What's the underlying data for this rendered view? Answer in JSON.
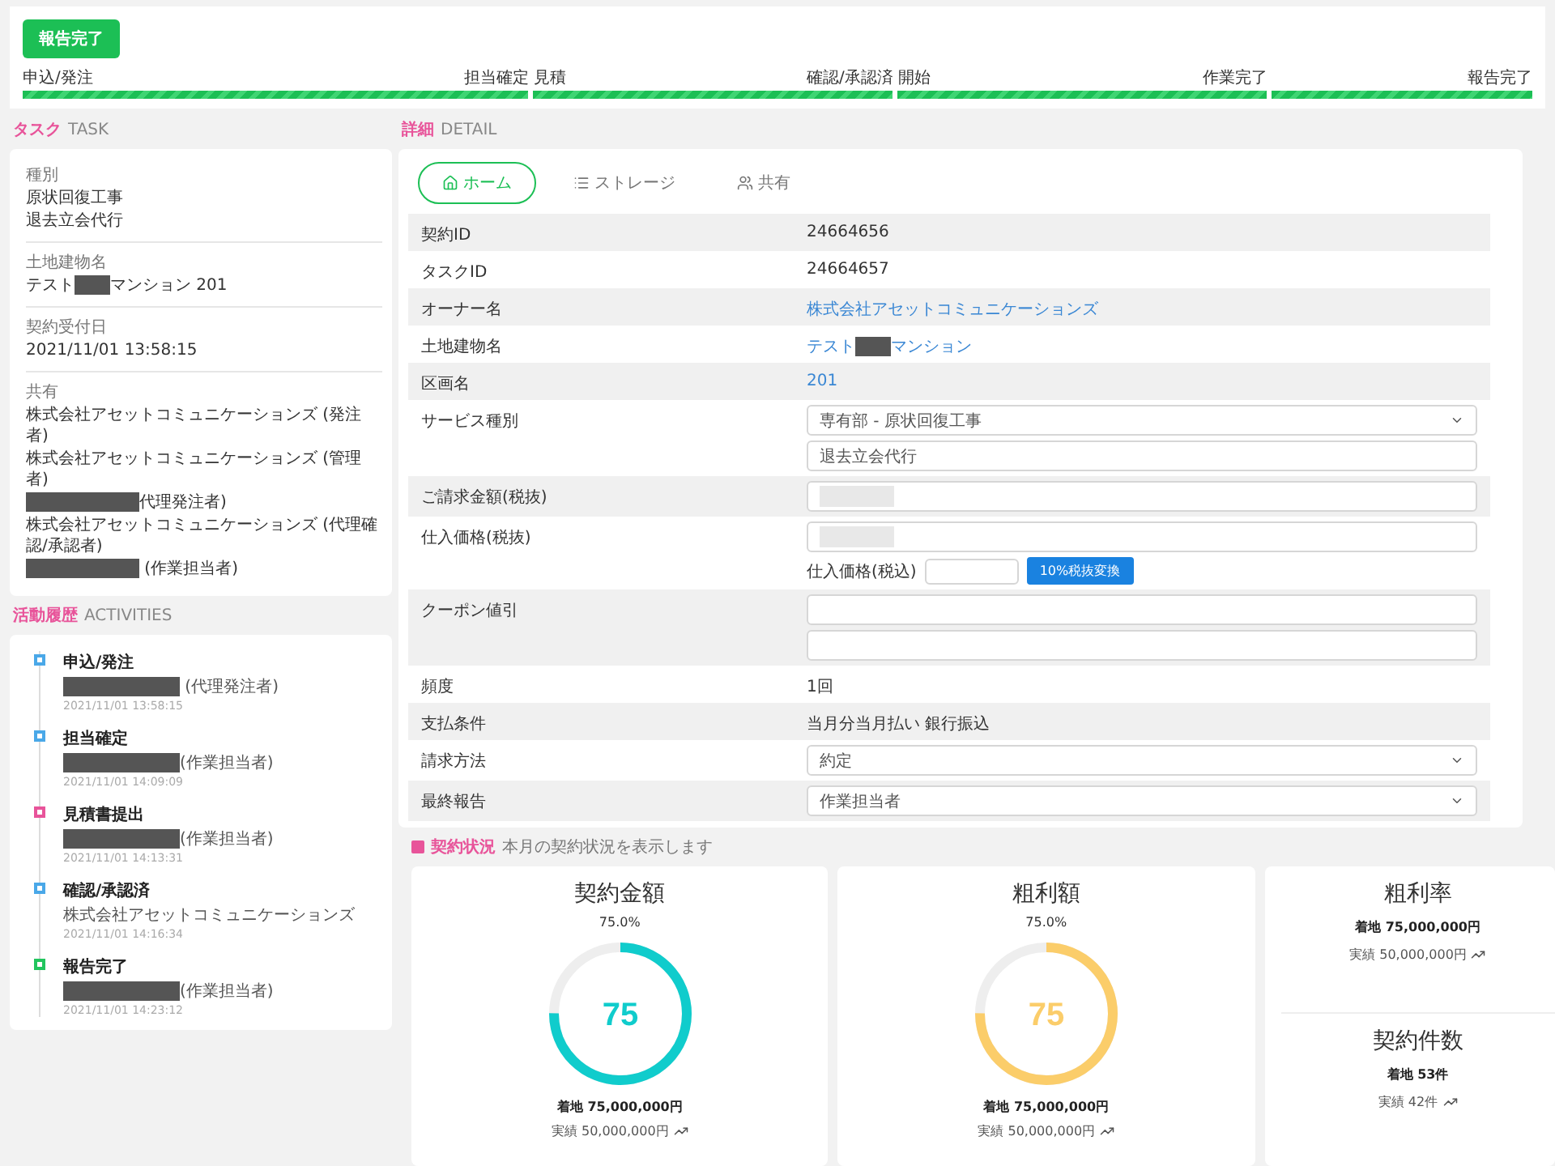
{
  "status_button": "報告完了",
  "progress": [
    {
      "start": "申込/発注",
      "end": "担当確定",
      "complete": true
    },
    {
      "start": "見積",
      "end": "確認/承認済",
      "complete": true
    },
    {
      "start": "開始",
      "end": "作業完了",
      "complete": true
    },
    {
      "end": "報告完了",
      "complete": true
    }
  ],
  "task": {
    "title": "タスク",
    "subtitle": "TASK",
    "fields": [
      {
        "label": "種別",
        "lines": [
          {
            "text": "原状回復工事"
          },
          {
            "text": "退去立会代行"
          }
        ]
      },
      {
        "label": "土地建物名",
        "lines": [
          {
            "before": "テスト",
            "after": "マンション 201",
            "redacted": true
          }
        ]
      },
      {
        "label": "契約受付日",
        "lines": [
          {
            "text": "2021/11/01 13:58:15"
          }
        ]
      },
      {
        "label": "共有",
        "lines": [
          {
            "text": "株式会社アセットコミュニケーションズ (発注者)"
          },
          {
            "text": "株式会社アセットコミュニケーションズ (管理者)"
          },
          {
            "after": "代理発注者)",
            "redacted": true
          },
          {
            "text": "株式会社アセットコミュニケーションズ (代理確認/承認者)"
          },
          {
            "after": " (作業担当者)",
            "redacted": true
          }
        ]
      }
    ]
  },
  "activities": {
    "title": "活動履歴",
    "subtitle": "ACTIVITIES",
    "items": [
      {
        "title": "申込/発注",
        "who": " (代理発注者)",
        "redacted": true,
        "time": "2021/11/01 13:58:15",
        "color": "#4aa8e8"
      },
      {
        "title": "担当確定",
        "who": "(作業担当者)",
        "redacted": true,
        "time": "2021/11/01 14:09:09",
        "color": "#4aa8e8"
      },
      {
        "title": "見積書提出",
        "who": "(作業担当者)",
        "redacted": true,
        "time": "2021/11/01 14:13:31",
        "color": "#e8549a"
      },
      {
        "title": "確認/承認済",
        "who": "株式会社アセットコミュニケーションズ",
        "redacted": false,
        "time": "2021/11/01 14:16:34",
        "color": "#4aa8e8"
      },
      {
        "title": "報告完了",
        "who": "(作業担当者)",
        "redacted": true,
        "time": "2021/11/01 14:23:12",
        "color": "#22c55e"
      }
    ]
  },
  "detail": {
    "title": "詳細",
    "subtitle": "DETAIL",
    "tabs": [
      {
        "label": "ホーム",
        "selected": true
      },
      {
        "label": "ストレージ",
        "selected": false
      },
      {
        "label": "共有",
        "selected": false
      }
    ],
    "rows": [
      {
        "label": "契約ID",
        "kind": "text",
        "value": "24664656"
      },
      {
        "label": "タスクID",
        "kind": "text",
        "value": "24664657"
      },
      {
        "label": "オーナー名",
        "kind": "link",
        "value": "株式会社アセットコミュニケーションズ"
      },
      {
        "label": "土地建物名",
        "kind": "link",
        "before": "テスト",
        "value": "マンション",
        "redacted": true
      },
      {
        "label": "区画名",
        "kind": "link",
        "value": "201"
      },
      {
        "label": "サービス種別",
        "kind": "fields",
        "fields": [
          {
            "kind": "select",
            "value": "専有部 - 原状回復工事"
          },
          {
            "kind": "input",
            "value": "退去立会代行"
          }
        ]
      },
      {
        "label": "ご請求金額(税抜)",
        "kind": "fields",
        "fields": [
          {
            "kind": "input",
            "masked": true
          }
        ]
      },
      {
        "label": "仕入価格(税抜)",
        "kind": "fields",
        "fields": [
          {
            "kind": "input",
            "masked": true
          }
        ],
        "tax": {
          "label": "仕入価格(税込)",
          "button": "10%税抜変換"
        }
      },
      {
        "label": "クーポン値引",
        "kind": "fields",
        "fields": [
          {
            "kind": "input"
          },
          {
            "kind": "input"
          }
        ]
      },
      {
        "label": "頻度",
        "kind": "text",
        "value": "1回"
      },
      {
        "label": "支払条件",
        "kind": "text",
        "value": "当月分当月払い 銀行振込"
      },
      {
        "label": "請求方法",
        "kind": "fields",
        "fields": [
          {
            "kind": "select",
            "value": "約定"
          }
        ]
      },
      {
        "label": "最終報告",
        "kind": "fields",
        "fields": [
          {
            "kind": "select",
            "value": "作業担当者"
          }
        ]
      }
    ]
  },
  "stats": {
    "title": "契約状況",
    "description": "本月の契約状況を表示します",
    "cards": [
      {
        "title": "契約金額",
        "percent": "75.0%",
        "gauge": {
          "level": 0.75,
          "label": "75",
          "color": "#10cccc"
        },
        "target_label": "着地",
        "target": "75,000,000円",
        "actual_label": "実績",
        "actual": "50,000,000円"
      },
      {
        "title": "粗利額",
        "percent": "75.0%",
        "gauge": {
          "level": 0.75,
          "label": "75",
          "color": "#fbcd6a"
        },
        "target_label": "着地",
        "target": "75,000,000円",
        "actual_label": "実績",
        "actual": "50,000,000円"
      }
    ],
    "side": [
      {
        "title": "粗利率",
        "target_label": "着地",
        "target": "75,000,000円",
        "actual_label": "実績",
        "actual": "50,000,000円"
      },
      {
        "title": "契約件数",
        "target_label": "着地",
        "target": "53件",
        "actual_label": "実績",
        "actual": "42件"
      }
    ]
  }
}
